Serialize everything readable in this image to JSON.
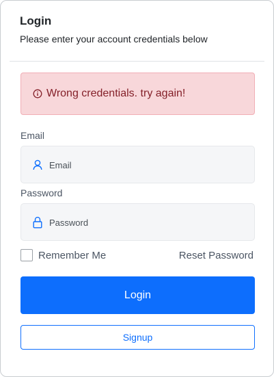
{
  "header": {
    "title": "Login",
    "subtitle": "Please enter your account credentials below"
  },
  "alert": {
    "icon": "info-circle-icon",
    "message": "Wrong credentials. try again!",
    "color": "#842029",
    "background": "#f8d7da"
  },
  "form": {
    "email": {
      "label": "Email",
      "placeholder": "Email",
      "value": "",
      "icon": "user-icon"
    },
    "password": {
      "label": "Password",
      "placeholder": "Password",
      "value": "",
      "icon": "lock-icon"
    },
    "remember_me": {
      "label": "Remember Me",
      "checked": false
    },
    "reset_password_label": "Reset Password"
  },
  "buttons": {
    "login_label": "Login",
    "signup_label": "Signup"
  },
  "colors": {
    "primary": "#0d6efd"
  }
}
